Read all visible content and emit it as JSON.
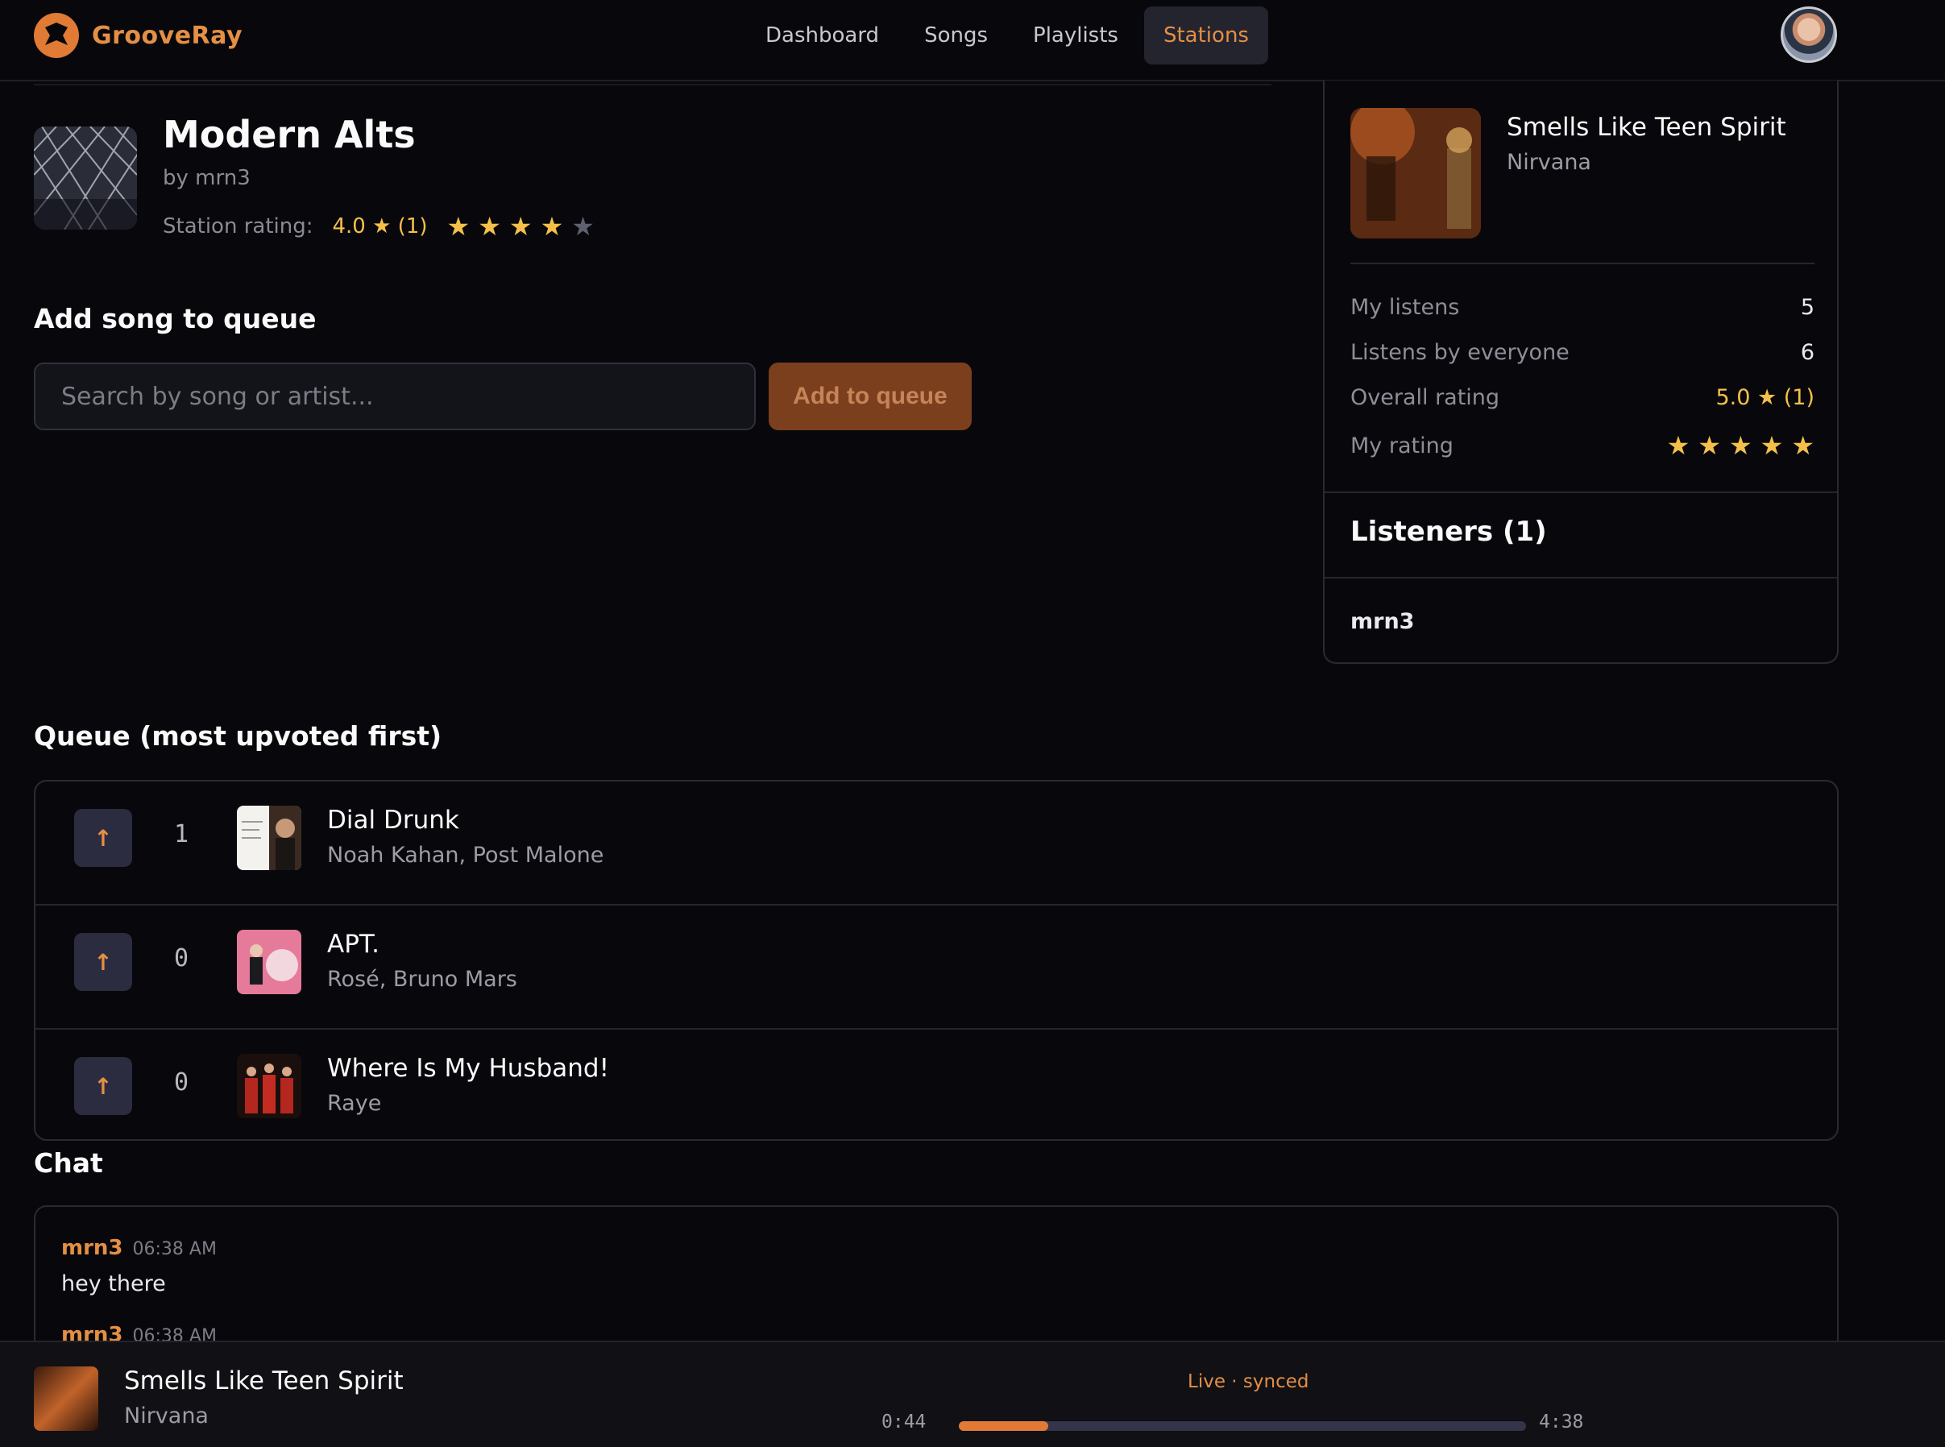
{
  "brand": {
    "name": "GrooveRay"
  },
  "nav": {
    "items": [
      {
        "label": "Dashboard"
      },
      {
        "label": "Songs"
      },
      {
        "label": "Playlists"
      },
      {
        "label": "Stations",
        "active": true
      }
    ]
  },
  "station": {
    "title": "Modern Alts",
    "by": "by mrn3",
    "rating_label": "Station rating:",
    "rating_value": "4.0 ★ (1)",
    "stars_filled": 4,
    "stars_total": 5
  },
  "add_song": {
    "heading": "Add song to queue",
    "placeholder": "Search by song or artist...",
    "button_label": "Add to queue"
  },
  "now_playing": {
    "title": "Smells Like Teen Spirit",
    "artist": "Nirvana",
    "stats": [
      {
        "label": "My listens",
        "value": "5"
      },
      {
        "label": "Listens by everyone",
        "value": "6"
      },
      {
        "label": "Overall rating",
        "value": "5.0 ★ (1)"
      },
      {
        "label": "My rating",
        "stars_filled": 5
      }
    ],
    "listeners_heading": "Listeners (1)",
    "listeners": [
      "mrn3"
    ]
  },
  "queue": {
    "heading": "Queue (most upvoted first)",
    "items": [
      {
        "votes": "1",
        "title": "Dial Drunk",
        "artist": "Noah Kahan, Post Malone"
      },
      {
        "votes": "0",
        "title": "APT.",
        "artist": "Rosé, Bruno Mars"
      },
      {
        "votes": "0",
        "title": "Where Is My Husband!",
        "artist": "Raye"
      }
    ]
  },
  "chat": {
    "heading": "Chat",
    "messages": [
      {
        "user": "mrn3",
        "time": "06:38 AM",
        "text": "hey there"
      },
      {
        "user": "mrn3",
        "time": "06:38 AM",
        "text": ""
      }
    ]
  },
  "player": {
    "title": "Smells Like Teen Spirit",
    "artist": "Nirvana",
    "status": "Live · synced",
    "current_time": "0:44",
    "total_time": "4:38",
    "progress": 0.158
  },
  "colors": {
    "accent": "#e48f45",
    "star": "#f5c04a",
    "background": "#08080c"
  },
  "icons": {
    "upvote": "arrow-up-icon",
    "star": "star-icon"
  }
}
